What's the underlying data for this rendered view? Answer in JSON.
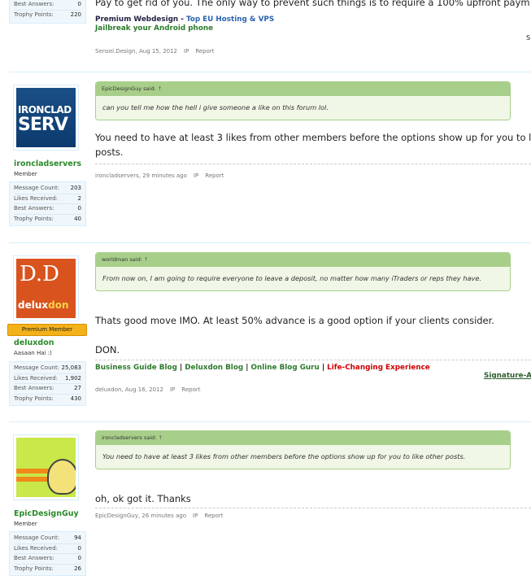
{
  "post1": {
    "stats": [
      {
        "label": "Best Answers:",
        "value": "0"
      },
      {
        "label": "Trophy Points:",
        "value": "220"
      }
    ],
    "message_top": "Pay to get rid of you. The only way to prevent such things is to require a 100% upfront paym",
    "signature": {
      "brand": "Premium Webdesign",
      "sep": " - ",
      "link": "Top EU Hosting & VPS",
      "line2": "Jailbreak your Android phone",
      "right": "S"
    },
    "meta": {
      "author": "Sensei.Design",
      "date": "Aug 15, 2012",
      "ip": "IP",
      "report": "Report"
    }
  },
  "post2": {
    "username": "ironcladservers",
    "usertitle": "Member",
    "avatar_text": [
      "IRONCLAD",
      "SERV"
    ],
    "stats": [
      {
        "label": "Message Count:",
        "value": "203"
      },
      {
        "label": "Likes Received:",
        "value": "2"
      },
      {
        "label": "Best Answers:",
        "value": "0"
      },
      {
        "label": "Trophy Points:",
        "value": "40"
      }
    ],
    "quote": {
      "author": "EpicDesignGuy",
      "said": "said:",
      "arrow": "↑",
      "text": "can you tell me how the hell i give someone a like on this forum lol."
    },
    "message_line1": "You need to have at least 3 likes from other members before the options show up for you to l",
    "message_line2": "posts.",
    "meta": {
      "author": "ironcladservers",
      "date": "29 minutes ago",
      "ip": "IP",
      "report": "Report"
    }
  },
  "post3": {
    "username": "deluxdon",
    "usertitle": "Aasaan Hai :)",
    "badge": "Premium Member",
    "avatar_text": {
      "top": "D.D",
      "bottom_a": "delux",
      "bottom_b": "don"
    },
    "stats": [
      {
        "label": "Message Count:",
        "value": "25,083"
      },
      {
        "label": "Likes Received:",
        "value": "1,902"
      },
      {
        "label": "Best Answers:",
        "value": "27"
      },
      {
        "label": "Trophy Points:",
        "value": "430"
      }
    ],
    "quote": {
      "author": "worldman",
      "said": "said:",
      "arrow": "↑",
      "text": "From now on, I am going to require everyone to leave a deposit, no matter how many iTraders or reps they have."
    },
    "message_line1": "Thats good move IMO. At least 50% advance is a good option if your clients consider.",
    "message_line2": "DON.",
    "signature": {
      "l1": "Business Guide Blog",
      "sep": " | ",
      "l2": "Deluxdon Blog",
      "l3": "Online Blog Guru",
      "l4": "Life-Changing Experience",
      "right": "Signature-A"
    },
    "meta": {
      "author": "deluxdon",
      "date": "Aug 16, 2012",
      "ip": "IP",
      "report": "Report"
    }
  },
  "post4": {
    "username": "EpicDesignGuy",
    "usertitle": "Member",
    "stats": [
      {
        "label": "Message Count:",
        "value": "94"
      },
      {
        "label": "Likes Received:",
        "value": "0"
      },
      {
        "label": "Best Answers:",
        "value": "0"
      },
      {
        "label": "Trophy Points:",
        "value": "26"
      }
    ],
    "quote": {
      "author": "ironcladservers",
      "said": "said:",
      "arrow": "↑",
      "text": "You need to have at least 3 likes from other members before the options show up for you to like other posts."
    },
    "message": "oh, ok got it. Thanks",
    "meta": {
      "author": "EpicDesignGuy",
      "date": "26 minutes ago",
      "ip": "IP",
      "report": "Report"
    }
  }
}
